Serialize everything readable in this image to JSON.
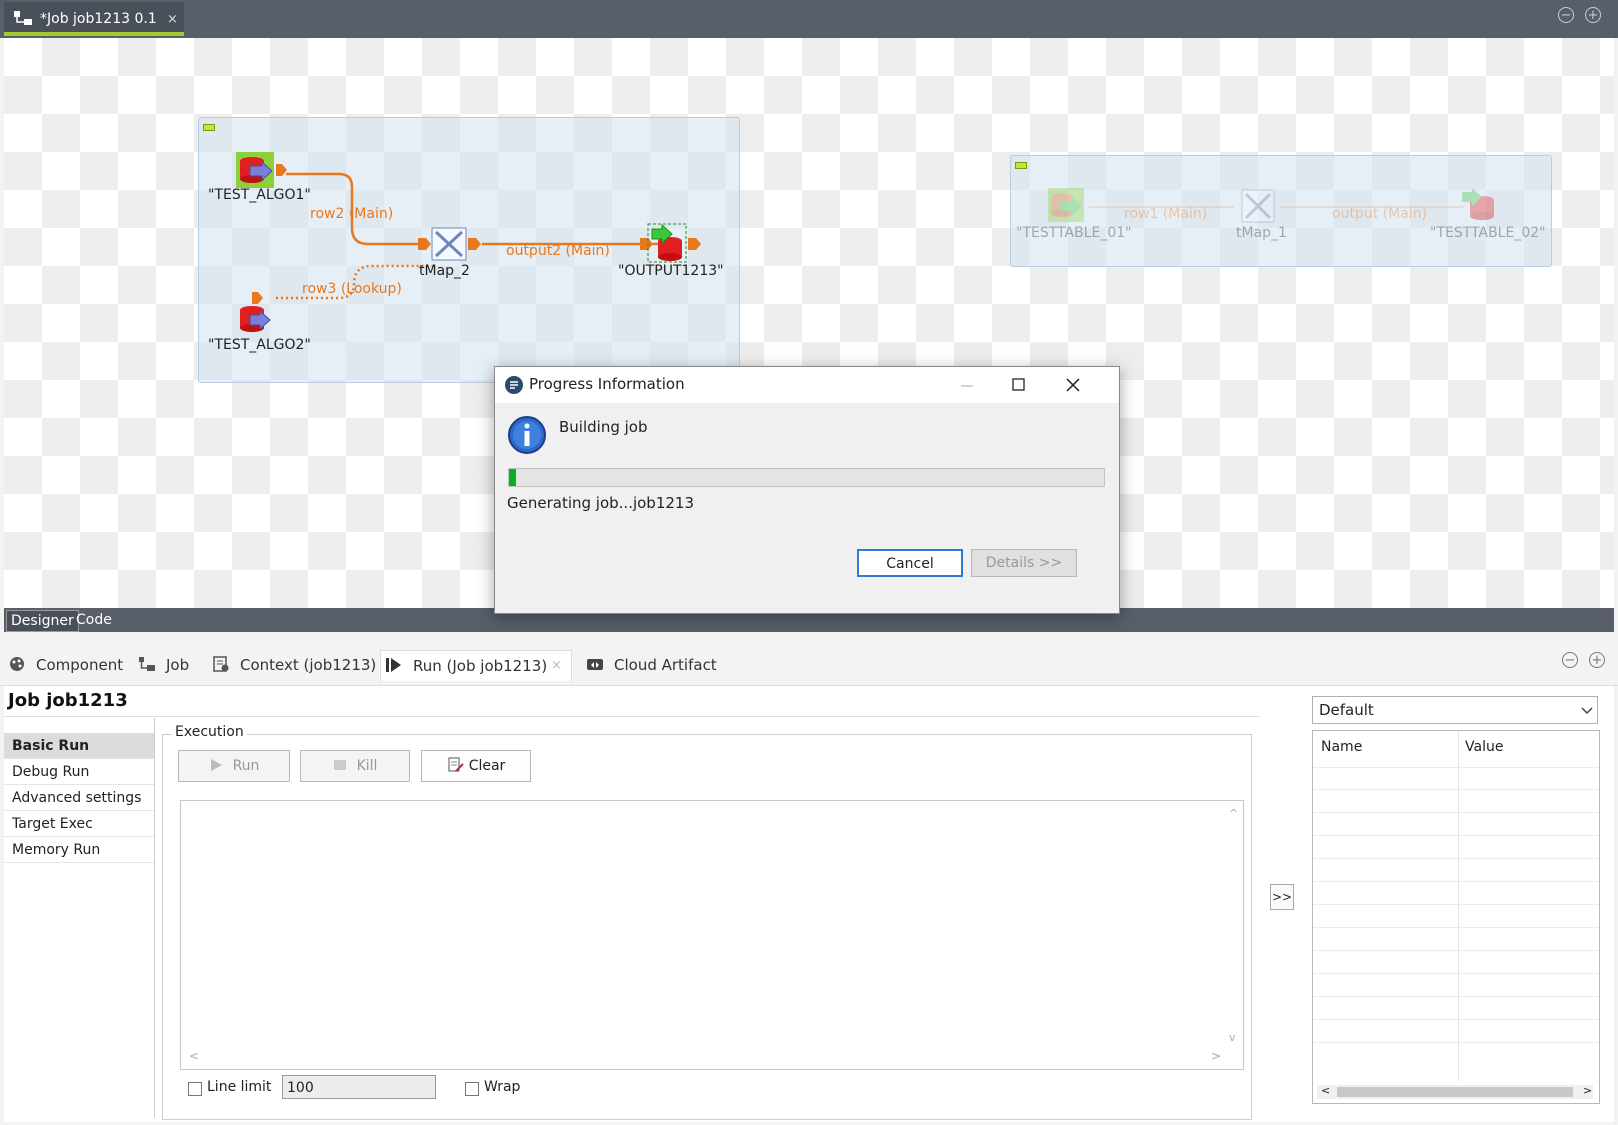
{
  "editor": {
    "tab_title": "*Job job1213 0.1",
    "close_glyph": "×",
    "minimize_glyph": "−",
    "maximize_glyph": "+",
    "bottom_tabs": [
      "Designer",
      "Code"
    ]
  },
  "canvas": {
    "subjob1": {
      "components": {
        "test_algo1": "\"TEST_ALGO1\"",
        "test_algo2": "\"TEST_ALGO2\"",
        "tmap_2": "tMap_2",
        "output1213": "\"OUTPUT1213\""
      },
      "links": {
        "row2": "row2 (Main)",
        "row3": "row3 (Lookup)",
        "output2": "output2 (Main)"
      }
    },
    "subjob2": {
      "components": {
        "testtable_01": "\"TESTTABLE_01\"",
        "tmap_1": "tMap_1",
        "testtable_02": "\"TESTTABLE_02\""
      },
      "links": {
        "row1": "row1 (Main)",
        "output": "output (Main)"
      }
    }
  },
  "bottom_panel": {
    "tabs": [
      {
        "label": "Component",
        "icon": "palette-icon"
      },
      {
        "label": "Job",
        "icon": "job-icon"
      },
      {
        "label": "Context (job1213)",
        "icon": "context-icon"
      },
      {
        "label": "Run (Job job1213)",
        "icon": "run-icon"
      },
      {
        "label": "Cloud Artifact",
        "icon": "cloud-icon"
      }
    ],
    "run_tab_close": "×",
    "job_title": "Job job1213",
    "side_nav": [
      "Basic Run",
      "Debug Run",
      "Advanced settings",
      "Target Exec",
      "Memory Run"
    ],
    "execution": {
      "group_label": "Execution",
      "run_label": "Run",
      "kill_label": "Kill",
      "clear_label": "Clear",
      "line_limit_label": "Line limit",
      "line_limit_value": "100",
      "wrap_label": "Wrap"
    },
    "arrow_button": ">>",
    "context": {
      "selected": "Default",
      "columns": [
        "Name",
        "Value"
      ]
    }
  },
  "dialog": {
    "title": "Progress Information",
    "task": "Building job",
    "subtask": "Generating job...job1213",
    "progress": 0.012,
    "progress_color": "#06b025",
    "cancel_label": "Cancel",
    "details_label": "Details >>"
  },
  "colors": {
    "accent_tab": "#a6c832",
    "link_orange": "#e8781e",
    "titlebar": "#585f6b"
  }
}
